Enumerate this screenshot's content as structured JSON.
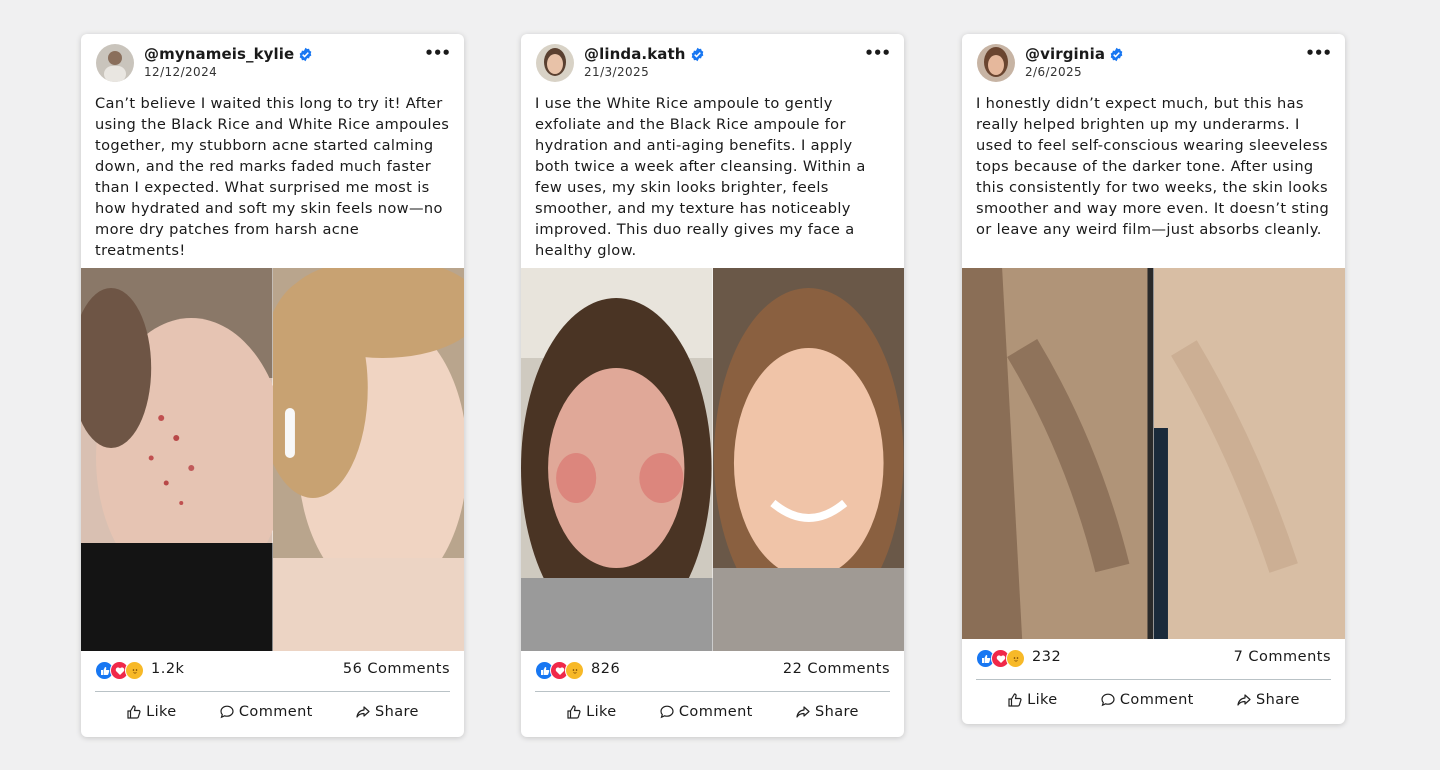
{
  "posts": [
    {
      "username": "@mynameis_kylie",
      "date": "12/12/2024",
      "text": "Can’t believe I waited this long to try it! After using the Black Rice and White Rice ampoules together, my stubborn acne started calming down, and the red marks faded much faster than I expected. What surprised me most is how hydrated and soft my skin feels now—no more dry patches from harsh acne treatments!",
      "reactions": "1.2k",
      "comments": "56 Comments",
      "like": "Like",
      "comment": "Comment",
      "share": "Share"
    },
    {
      "username": "@linda.kath",
      "date": "21/3/2025",
      "text": "I use the White Rice ampoule to gently exfoliate and the Black Rice ampoule for hydration and anti-aging benefits. I apply both twice a week after cleansing. Within a few uses, my skin looks brighter, feels smoother, and my texture has noticeably improved. This duo really gives my face a healthy glow.",
      "reactions": "826",
      "comments": "22 Comments",
      "like": "Like",
      "comment": "Comment",
      "share": "Share"
    },
    {
      "username": "@virginia",
      "date": "2/6/2025",
      "text": "I honestly didn’t expect much, but this has really helped brighten up my underarms. I used to feel self-conscious wearing sleeveless tops because of the darker tone. After using this consistently for two weeks, the skin looks smoother and way more even. It doesn’t sting or leave any weird film—just absorbs cleanly.",
      "reactions": "232",
      "comments": "7 Comments",
      "like": "Like",
      "comment": "Comment",
      "share": "Share"
    }
  ],
  "colors": {
    "verified": "#1877f2",
    "like_reaction": "#1877f2",
    "love_reaction": "#f02849",
    "care_reaction": "#f7b928"
  }
}
